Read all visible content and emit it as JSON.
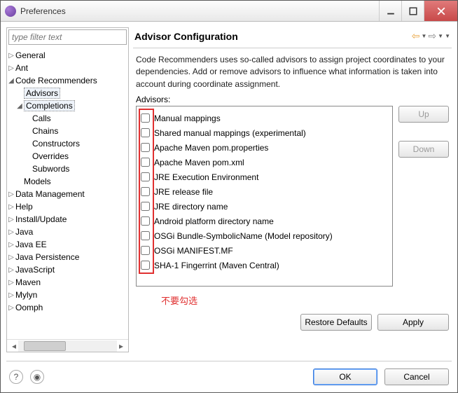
{
  "window": {
    "title": "Preferences"
  },
  "filter": {
    "placeholder": "type filter text"
  },
  "tree": {
    "general": "General",
    "ant": "Ant",
    "coderec": "Code Recommenders",
    "advisors": "Advisors",
    "completions": "Completions",
    "calls": "Calls",
    "chains": "Chains",
    "constructors": "Constructors",
    "overrides": "Overrides",
    "subwords": "Subwords",
    "models": "Models",
    "datamgmt": "Data Management",
    "help": "Help",
    "installupdate": "Install/Update",
    "java": "Java",
    "javaee": "Java EE",
    "javapersist": "Java Persistence",
    "javascript": "JavaScript",
    "maven": "Maven",
    "mylyn": "Mylyn",
    "oomph": "Oomph"
  },
  "page": {
    "title": "Advisor Configuration",
    "desc": "Code Recommenders uses so-called advisors to assign project coordinates to your dependencies. Add or remove advisors to influence what information is taken into account during coordinate assignment.",
    "advisors_label": "Advisors:"
  },
  "advisors": [
    "Manual mappings",
    "Shared manual mappings (experimental)",
    "Apache Maven pom.properties",
    "Apache Maven pom.xml",
    "JRE Execution Environment",
    "JRE release file",
    "JRE directory name",
    "Android platform directory name",
    "OSGi Bundle-SymbolicName (Model repository)",
    "OSGi MANIFEST.MF",
    "SHA-1 Fingerrint (Maven Central)"
  ],
  "buttons": {
    "up": "Up",
    "down": "Down",
    "restore": "Restore Defaults",
    "apply": "Apply",
    "ok": "OK",
    "cancel": "Cancel"
  },
  "annotation": "不要勾选"
}
